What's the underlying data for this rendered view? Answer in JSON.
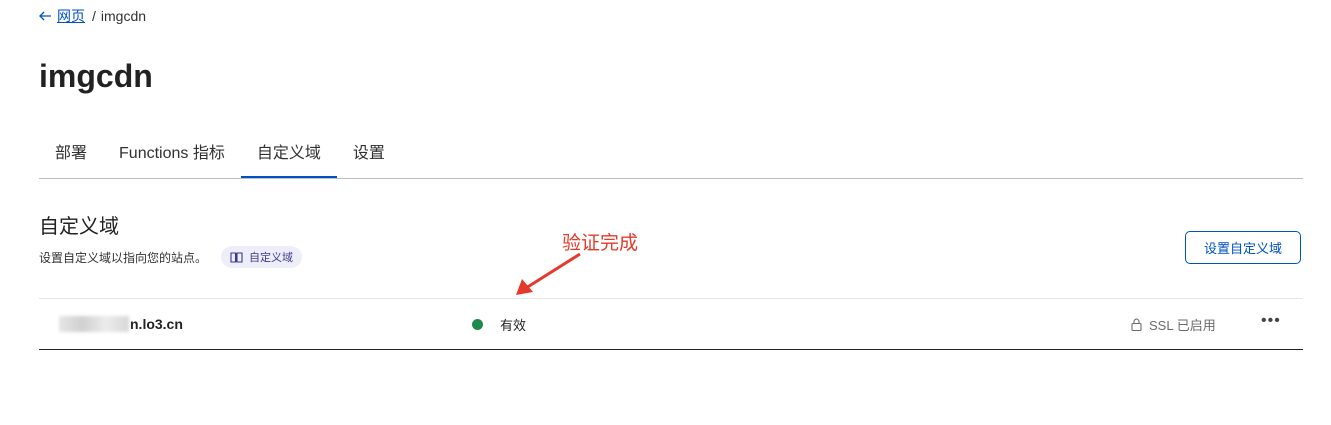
{
  "breadcrumb": {
    "back_label": "网页",
    "separator": "/",
    "current": "imgcdn"
  },
  "page": {
    "title": "imgcdn"
  },
  "tabs": [
    {
      "label": "部署"
    },
    {
      "label": "Functions 指标"
    },
    {
      "label": "自定义域",
      "active": true
    },
    {
      "label": "设置"
    }
  ],
  "section": {
    "title": "自定义域",
    "description": "设置自定义域以指向您的站点。",
    "doc_link": "自定义域",
    "action_button": "设置自定义域"
  },
  "annotation": {
    "text": "验证完成",
    "color": "#e53a2b"
  },
  "domains": [
    {
      "name_visible": "n.lo3.cn",
      "status": "有效",
      "status_color": "#1f8a4c",
      "ssl": "SSL 已启用",
      "more": "•••"
    }
  ],
  "colors": {
    "accent": "#0051c3"
  },
  "icons": [
    "arrow-left-icon",
    "book-icon",
    "lock-icon",
    "more-icon"
  ]
}
